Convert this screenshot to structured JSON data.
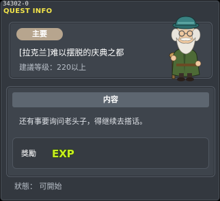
{
  "window": {
    "quest_id": "34302-0",
    "title": "QUEST INFO"
  },
  "info": {
    "category": "主要",
    "quest_name": "[拉克兰]难以摆脱的庆典之都",
    "required_level": "建議等级：220以上"
  },
  "npc": {
    "icon": "old-man-npc-portrait"
  },
  "content": {
    "header": "内容",
    "text": "还有事要询问老头子，得继续去搭话。"
  },
  "reward": {
    "label": "獎勵",
    "exp_text": "EXP",
    "icon": "exp-icon"
  },
  "status": {
    "text": "狀態： 可開始"
  },
  "colors": {
    "title": "#f2e44a",
    "category_tag": "#b7a58e",
    "exp_fill": "#c8f01e",
    "panel_bg": "#3e444c"
  }
}
